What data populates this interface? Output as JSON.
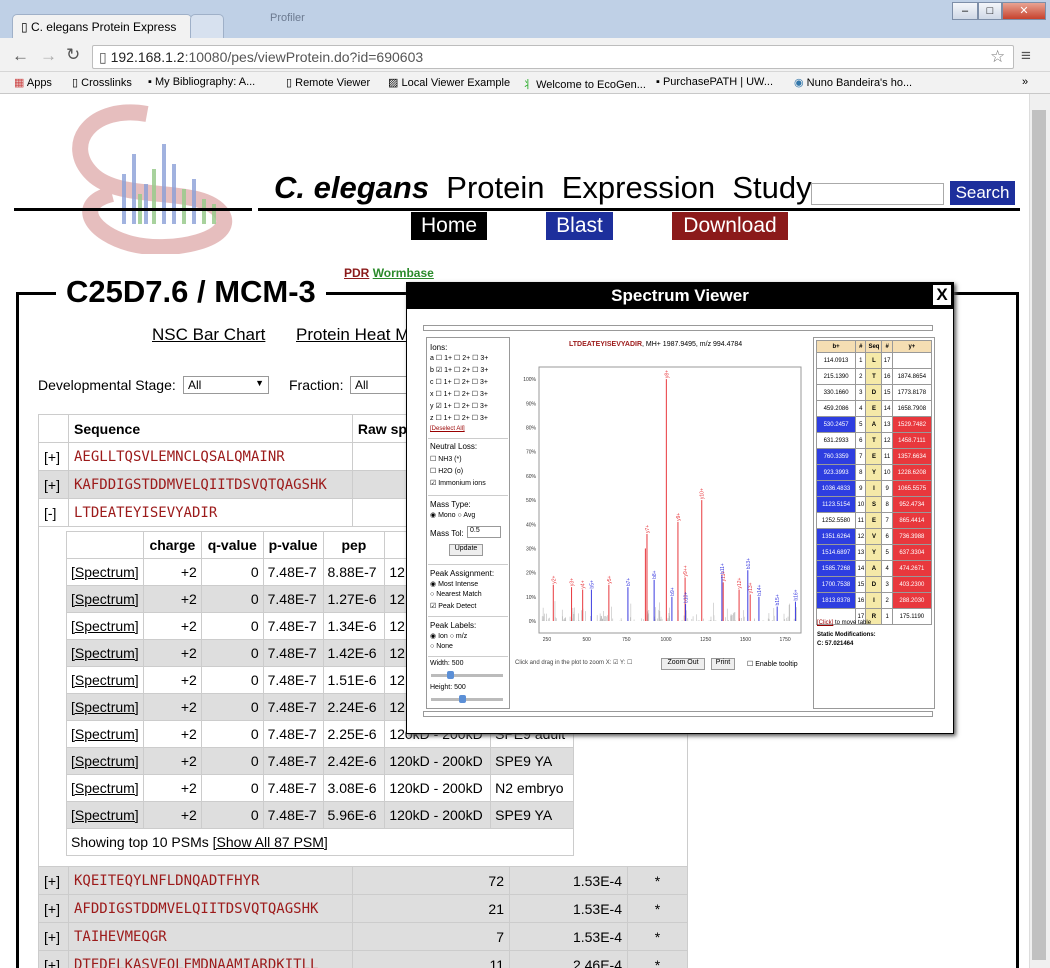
{
  "browser": {
    "tabs": [
      {
        "label": "C. elegans Protein Express"
      },
      {
        "label": ""
      }
    ],
    "bg_title": "Profiler",
    "url_host": "192.168.1.2",
    "url_rest": ":10080/pes/viewProtein.do?id=690603",
    "bookmarks": [
      "Apps",
      "Crosslinks",
      "My Bibliography: A...",
      "Remote Viewer",
      "Local Viewer Example",
      "Welcome to EcoGen...",
      "PurchasePATH | UW...",
      "Nuno Bandeira's ho..."
    ],
    "window_buttons": [
      "–",
      "□",
      "✕"
    ]
  },
  "site": {
    "title_italic": "C. elegans",
    "title_rest": "Protein  Expression  Study",
    "search_label": "Search",
    "nav": [
      {
        "label": "Home",
        "color": "#000000"
      },
      {
        "label": "Blast",
        "color": "#1d2f9c"
      },
      {
        "label": "Download",
        "color": "#8b1a1a"
      }
    ]
  },
  "protein": {
    "title": "C25D7.6 / MCM-3",
    "links": [
      "PDR",
      "Wormbase"
    ],
    "subnav": [
      "NSC Bar Chart",
      "Protein Heat M"
    ],
    "stage_label": "Developmental Stage:",
    "stage_value": "All",
    "fraction_label": "Fraction:",
    "fraction_value": "All"
  },
  "seq_table": {
    "headers": [
      "Sequence",
      "Raw sp"
    ],
    "rows_top": [
      {
        "toggle": "[+]",
        "seq": "AEGLLTQSVLEMNCLQSALQMAINR"
      },
      {
        "toggle": "[+]",
        "seq": "KAFDDIGSTDDMVELQIITDSVQTQAGSHK"
      },
      {
        "toggle": "[-]",
        "seq": "LTDEATEYISEVYADIR"
      }
    ],
    "rows_bottom": [
      {
        "toggle": "[+]",
        "seq": "KQEITEQYLNFLDNQADTFHYR",
        "raw": "72",
        "p": "1.53E-4",
        "star": "*"
      },
      {
        "toggle": "[+]",
        "seq": "AFDDIGSTDDMVELQIITDSVQTQAGSHK",
        "raw": "21",
        "p": "1.53E-4",
        "star": "*"
      },
      {
        "toggle": "[+]",
        "seq": "TAIHEVMEQGR",
        "raw": "7",
        "p": "1.53E-4",
        "star": "*"
      },
      {
        "toggle": "[+]",
        "seq": "DTEDELKASVEQLEMDNAAMIARDKITLL",
        "raw": "11",
        "p": "2.46E-4",
        "star": "*"
      }
    ]
  },
  "psm": {
    "headers": [
      "",
      "charge",
      "q-value",
      "p-value",
      "pep",
      "Fra"
    ],
    "rows": [
      {
        "link": "[Spectrum]",
        "charge": "+2",
        "q": "0",
        "p": "7.48E-7",
        "pep": "8.88E-7",
        "frac": "12",
        "sample": ""
      },
      {
        "link": "[Spectrum]",
        "charge": "+2",
        "q": "0",
        "p": "7.48E-7",
        "pep": "1.27E-6",
        "frac": "12",
        "sample": ""
      },
      {
        "link": "[Spectrum]",
        "charge": "+2",
        "q": "0",
        "p": "7.48E-7",
        "pep": "1.34E-6",
        "frac": "12",
        "sample": ""
      },
      {
        "link": "[Spectrum]",
        "charge": "+2",
        "q": "0",
        "p": "7.48E-7",
        "pep": "1.42E-6",
        "frac": "12",
        "sample": ""
      },
      {
        "link": "[Spectrum]",
        "charge": "+2",
        "q": "0",
        "p": "7.48E-7",
        "pep": "1.51E-6",
        "frac": "12",
        "sample": ""
      },
      {
        "link": "[Spectrum]",
        "charge": "+2",
        "q": "0",
        "p": "7.48E-7",
        "pep": "2.24E-6",
        "frac": "12",
        "sample": ""
      },
      {
        "link": "[Spectrum]",
        "charge": "+2",
        "q": "0",
        "p": "7.48E-7",
        "pep": "2.25E-6",
        "frac": "120kD - 200kD",
        "sample": "SPE9 adult"
      },
      {
        "link": "[Spectrum]",
        "charge": "+2",
        "q": "0",
        "p": "7.48E-7",
        "pep": "2.42E-6",
        "frac": "120kD - 200kD",
        "sample": "SPE9 YA"
      },
      {
        "link": "[Spectrum]",
        "charge": "+2",
        "q": "0",
        "p": "7.48E-7",
        "pep": "3.08E-6",
        "frac": "120kD - 200kD",
        "sample": "N2 embryo"
      },
      {
        "link": "[Spectrum]",
        "charge": "+2",
        "q": "0",
        "p": "7.48E-7",
        "pep": "5.96E-6",
        "frac": "120kD - 200kD",
        "sample": "SPE9 YA"
      }
    ],
    "footer_text": "Showing top 10 PSMs ",
    "footer_link": "[Show All 87 PSM]"
  },
  "spectrum": {
    "title": "Spectrum Viewer",
    "close": "X",
    "peptide": "LTDEATEYISEVYADIR",
    "mh_info": ", MH+ 1987.9495, m/z 994.4784",
    "ions_label": "Ions:",
    "ions": [
      "a",
      "b",
      "c",
      "x",
      "y",
      "z"
    ],
    "charges": [
      "1+",
      "2+",
      "3+"
    ],
    "ions_checked": [
      "b",
      "y"
    ],
    "deselect": "[Deselect All]",
    "neutral_loss_label": "Neutral Loss:",
    "neutral_loss": [
      "NH3 (*)",
      "H2O (o)",
      "Immonium ions"
    ],
    "mass_type_label": "Mass Type:",
    "mass_type": [
      "Mono",
      "Avg"
    ],
    "mass_tol_label": "Mass Tol:",
    "mass_tol": "0.5",
    "update": "Update",
    "peak_assign_label": "Peak Assignment:",
    "peak_assign": [
      "Most Intense",
      "Nearest Match",
      "Peak Detect"
    ],
    "peak_labels_label": "Peak Labels:",
    "peak_labels": [
      "Ion",
      "m/z",
      "None"
    ],
    "width_label": "Width: 500",
    "height_label": "Height: 500",
    "zoom_hint": "Click and drag in the plot to zoom X:",
    "y_label": "Y:",
    "zoom_out": "Zoom Out",
    "print": "Print",
    "tooltip": "Enable tooltip",
    "click_link": "[Click]",
    "click_text": " to move table",
    "static_mod_label": "Static Modifications:",
    "static_mod": "C: 57.021464",
    "table_headers": [
      "b+",
      "#",
      "Seq",
      "#",
      "y+"
    ],
    "table": [
      {
        "b": "114.0913",
        "n": "1",
        "aa": "L",
        "m": "17",
        "y": "",
        "bh": false,
        "yh": false
      },
      {
        "b": "215.1390",
        "n": "2",
        "aa": "T",
        "m": "16",
        "y": "1874.8654",
        "bh": false,
        "yh": false
      },
      {
        "b": "330.1660",
        "n": "3",
        "aa": "D",
        "m": "15",
        "y": "1773.8178",
        "bh": false,
        "yh": false
      },
      {
        "b": "459.2086",
        "n": "4",
        "aa": "E",
        "m": "14",
        "y": "1658.7908",
        "bh": false,
        "yh": false
      },
      {
        "b": "530.2457",
        "n": "5",
        "aa": "A",
        "m": "13",
        "y": "1529.7482",
        "bh": true,
        "yh": true
      },
      {
        "b": "631.2933",
        "n": "6",
        "aa": "T",
        "m": "12",
        "y": "1458.7111",
        "bh": false,
        "yh": true
      },
      {
        "b": "760.3359",
        "n": "7",
        "aa": "E",
        "m": "11",
        "y": "1357.6634",
        "bh": true,
        "yh": true
      },
      {
        "b": "923.3993",
        "n": "8",
        "aa": "Y",
        "m": "10",
        "y": "1228.6208",
        "bh": true,
        "yh": true
      },
      {
        "b": "1036.4833",
        "n": "9",
        "aa": "I",
        "m": "9",
        "y": "1065.5575",
        "bh": true,
        "yh": true
      },
      {
        "b": "1123.5154",
        "n": "10",
        "aa": "S",
        "m": "8",
        "y": "952.4734",
        "bh": true,
        "yh": true
      },
      {
        "b": "1252.5580",
        "n": "11",
        "aa": "E",
        "m": "7",
        "y": "865.4414",
        "bh": false,
        "yh": true
      },
      {
        "b": "1351.6264",
        "n": "12",
        "aa": "V",
        "m": "6",
        "y": "736.3988",
        "bh": true,
        "yh": true
      },
      {
        "b": "1514.6897",
        "n": "13",
        "aa": "Y",
        "m": "5",
        "y": "637.3304",
        "bh": true,
        "yh": true
      },
      {
        "b": "1585.7268",
        "n": "14",
        "aa": "A",
        "m": "4",
        "y": "474.2671",
        "bh": true,
        "yh": true
      },
      {
        "b": "1700.7538",
        "n": "15",
        "aa": "D",
        "m": "3",
        "y": "403.2300",
        "bh": true,
        "yh": true
      },
      {
        "b": "1813.8378",
        "n": "16",
        "aa": "I",
        "m": "2",
        "y": "288.2030",
        "bh": true,
        "yh": true
      },
      {
        "b": "",
        "n": "17",
        "aa": "R",
        "m": "1",
        "y": "175.1190",
        "bh": false,
        "yh": false
      }
    ],
    "y_ticks": [
      "0%",
      "10%",
      "20%",
      "30%",
      "40%",
      "50%",
      "60%",
      "70%",
      "80%",
      "90%",
      "100%"
    ],
    "x_ticks": [
      "250",
      "500",
      "750",
      "1000",
      "1250",
      "1500",
      "1750"
    ],
    "peaks": [
      {
        "mz": 1002,
        "h": 100,
        "c": "#e8383d",
        "l": "y8+"
      },
      {
        "mz": 880,
        "h": 36,
        "c": "#e8383d",
        "l": "y7+"
      },
      {
        "mz": 1075,
        "h": 41,
        "c": "#e8383d",
        "l": "y9+"
      },
      {
        "mz": 1225,
        "h": 50,
        "c": "#e8383d",
        "l": "y10+"
      },
      {
        "mz": 1120,
        "h": 18,
        "c": "#e8383d",
        "l": "y9++"
      },
      {
        "mz": 290,
        "h": 15,
        "c": "#e8383d",
        "l": "y2+"
      },
      {
        "mz": 405,
        "h": 14,
        "c": "#e8383d",
        "l": "y3+"
      },
      {
        "mz": 475,
        "h": 13,
        "c": "#e8383d",
        "l": "y4+"
      },
      {
        "mz": 640,
        "h": 15,
        "c": "#e8383d",
        "l": "y5+"
      },
      {
        "mz": 870,
        "h": 30,
        "c": "#e8383d",
        "l": ""
      },
      {
        "mz": 1360,
        "h": 16,
        "c": "#e8383d",
        "l": "y11+"
      },
      {
        "mz": 1460,
        "h": 13,
        "c": "#e8383d",
        "l": "y12+"
      },
      {
        "mz": 1530,
        "h": 11,
        "c": "#e8383d",
        "l": "y13+"
      },
      {
        "mz": 530,
        "h": 13,
        "c": "#3a3ae0",
        "l": "b5+"
      },
      {
        "mz": 760,
        "h": 14,
        "c": "#3a3ae0",
        "l": "b7+"
      },
      {
        "mz": 925,
        "h": 17,
        "c": "#3a3ae0",
        "l": "b8+"
      },
      {
        "mz": 1037,
        "h": 10,
        "c": "#3a3ae0",
        "l": "b9+"
      },
      {
        "mz": 1123,
        "h": 7,
        "c": "#3a3ae0",
        "l": "b10+"
      },
      {
        "mz": 1352,
        "h": 19,
        "c": "#3a3ae0",
        "l": "b11+"
      },
      {
        "mz": 1515,
        "h": 21,
        "c": "#3a3ae0",
        "l": "b13+"
      },
      {
        "mz": 1585,
        "h": 10,
        "c": "#3a3ae0",
        "l": "b14+"
      },
      {
        "mz": 1700,
        "h": 6,
        "c": "#3a3ae0",
        "l": "b15+"
      },
      {
        "mz": 1815,
        "h": 8,
        "c": "#3a3ae0",
        "l": "b16+"
      }
    ]
  }
}
